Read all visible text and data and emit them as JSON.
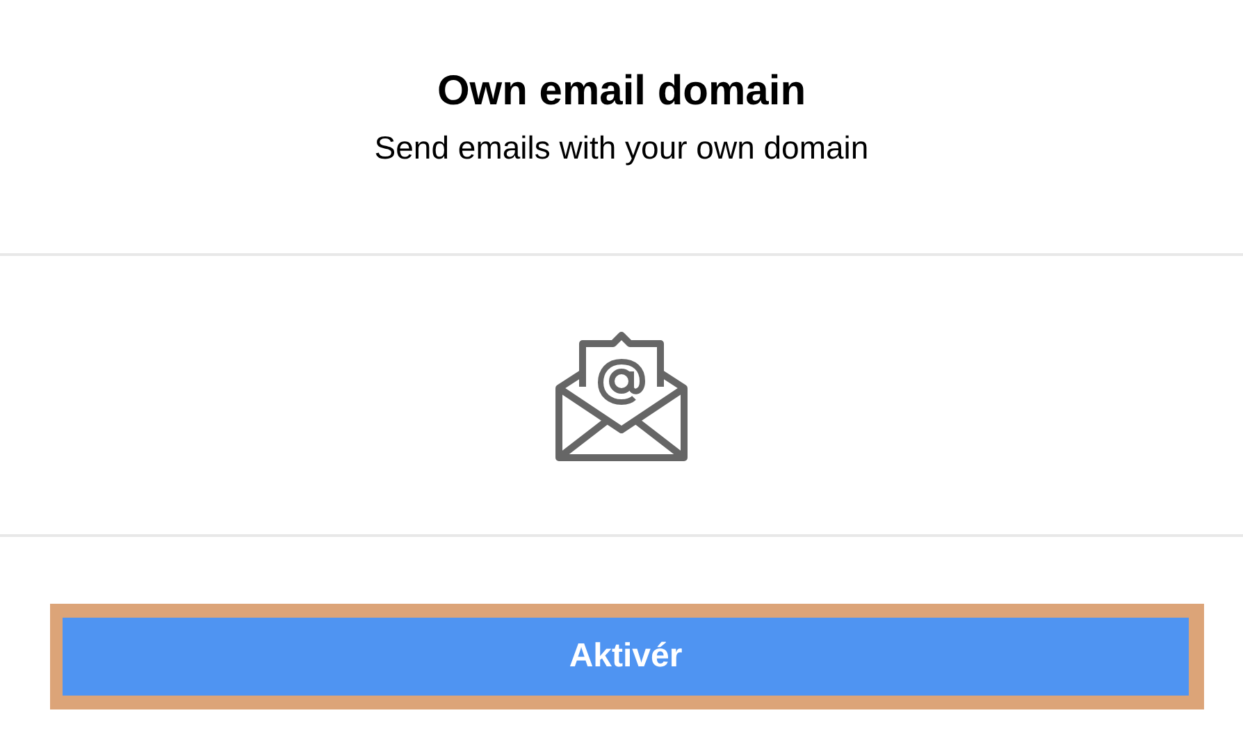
{
  "header": {
    "title": "Own email domain",
    "subtitle": "Send emails with your own domain"
  },
  "button": {
    "label": "Aktivér",
    "focused": true
  }
}
